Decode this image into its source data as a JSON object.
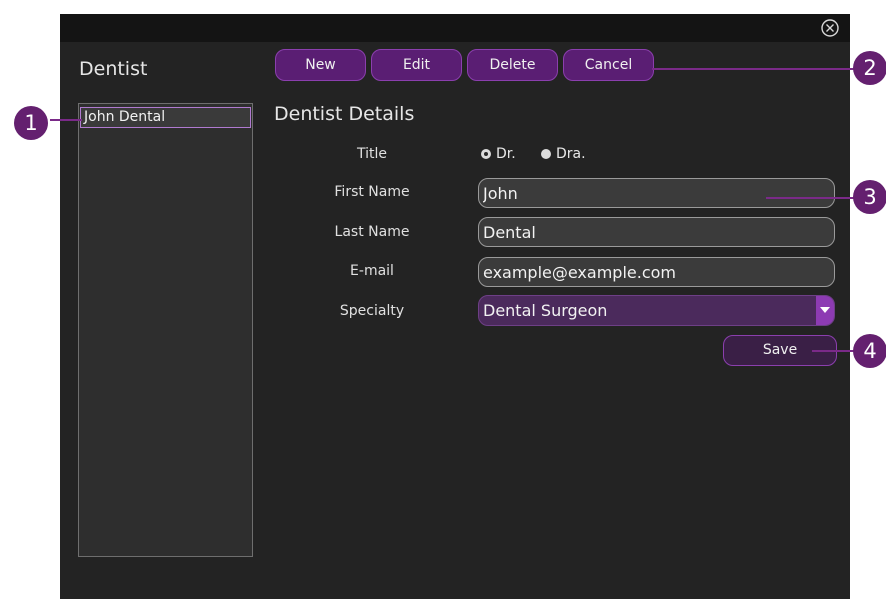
{
  "window": {
    "title": "Dentist",
    "close_icon": "close-circle-icon"
  },
  "toolbar": {
    "buttons": [
      "New",
      "Edit",
      "Delete",
      "Cancel"
    ]
  },
  "dentist_list": {
    "items": [
      "John Dental"
    ],
    "selected_index": 0
  },
  "details": {
    "title": "Dentist Details",
    "title_label": "Title",
    "title_options": [
      {
        "label": "Dr.",
        "checked": true
      },
      {
        "label": "Dra.",
        "checked": false
      }
    ],
    "first_name_label": "First Name",
    "first_name_value": "John",
    "last_name_label": "Last Name",
    "last_name_value": "Dental",
    "email_label": "E-mail",
    "email_value": "example@example.com",
    "specialty_label": "Specialty",
    "specialty_value": "Dental Surgeon",
    "save_label": "Save"
  },
  "callouts": [
    "1",
    "2",
    "3",
    "4"
  ],
  "colors": {
    "accent": "#5a1e73",
    "accent_border": "#8b3fae",
    "callout": "#64206f",
    "window_bg": "#232323"
  }
}
